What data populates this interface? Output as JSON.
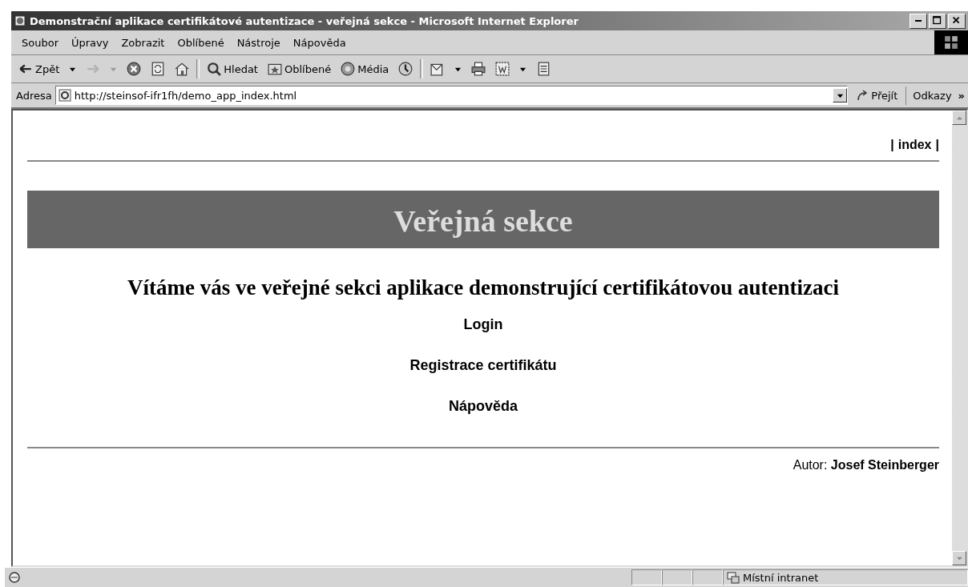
{
  "window": {
    "title": "Demonstrační aplikace certifikátové autentizace - veřejná sekce - Microsoft Internet Explorer"
  },
  "menu": [
    "Soubor",
    "Úpravy",
    "Zobrazit",
    "Oblíbené",
    "Nástroje",
    "Nápověda"
  ],
  "toolbar": [
    {
      "kind": "back",
      "label": "Zpět",
      "dropdown": true,
      "disabled": false
    },
    {
      "kind": "forward",
      "dropdown": true,
      "disabled": true
    },
    {
      "kind": "stop",
      "dropdown": false,
      "disabled": false
    },
    {
      "kind": "refresh",
      "dropdown": false,
      "disabled": false
    },
    {
      "kind": "home",
      "dropdown": false,
      "disabled": false
    },
    {
      "kind": "separator"
    },
    {
      "kind": "search",
      "label": "Hledat",
      "dropdown": false,
      "disabled": false
    },
    {
      "kind": "favorites",
      "label": "Oblíbené",
      "dropdown": false,
      "disabled": false
    },
    {
      "kind": "media",
      "label": "Média",
      "dropdown": false,
      "disabled": false
    },
    {
      "kind": "history",
      "dropdown": false,
      "disabled": false
    },
    {
      "kind": "separator"
    },
    {
      "kind": "mail",
      "dropdown": true,
      "disabled": false
    },
    {
      "kind": "print",
      "dropdown": false,
      "disabled": false
    },
    {
      "kind": "edit",
      "dropdown": true,
      "disabled": false
    },
    {
      "kind": "discuss",
      "dropdown": false,
      "disabled": false
    }
  ],
  "address": {
    "label": "Adresa",
    "url": "http://steinsof-ifr1fh/demo_app_index.html",
    "go": "Přejít",
    "links": "Odkazy",
    "more": "»"
  },
  "page": {
    "nav_before": "|",
    "nav_link": "index",
    "nav_after": "|",
    "banner": "Veřejná sekce",
    "heading": "Vítáme vás ve veřejné sekci aplikace demonstrující certifikátovou autentizaci",
    "links": [
      "Login",
      "Registrace certifikátu",
      "Nápověda"
    ],
    "author_label": "Autor:",
    "author": "Josef Steinberger"
  },
  "status_bar": {
    "zone": "Místní intranet"
  }
}
